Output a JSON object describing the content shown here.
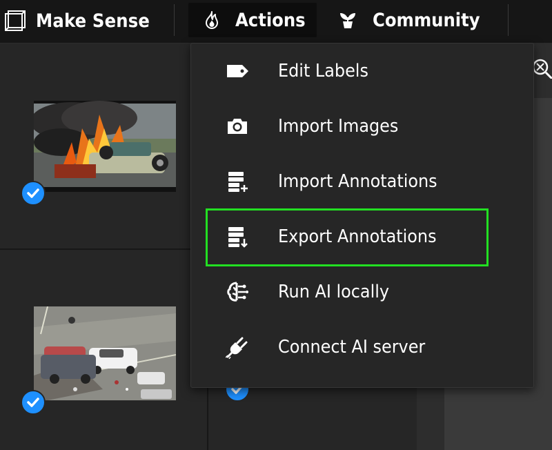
{
  "app": {
    "title": "Make Sense"
  },
  "nav": {
    "actions_label": "Actions",
    "community_label": "Community"
  },
  "menu": {
    "items": [
      {
        "label": "Edit Labels",
        "icon": "tag-icon"
      },
      {
        "label": "Import Images",
        "icon": "camera-icon"
      },
      {
        "label": "Import Annotations",
        "icon": "import-annotations-icon"
      },
      {
        "label": "Export Annotations",
        "icon": "export-annotations-icon",
        "highlighted": true
      },
      {
        "label": "Run AI locally",
        "icon": "brain-icon"
      },
      {
        "label": "Connect AI server",
        "icon": "plug-icon"
      }
    ]
  },
  "thumbnails": [
    {
      "name": "burning-car-thumbnail",
      "checked": true
    },
    {
      "name": "car-crash-thumbnail",
      "checked": true
    }
  ],
  "colors": {
    "highlight": "#22e022",
    "check": "#1e90ff",
    "background": "#1e1e1e"
  }
}
